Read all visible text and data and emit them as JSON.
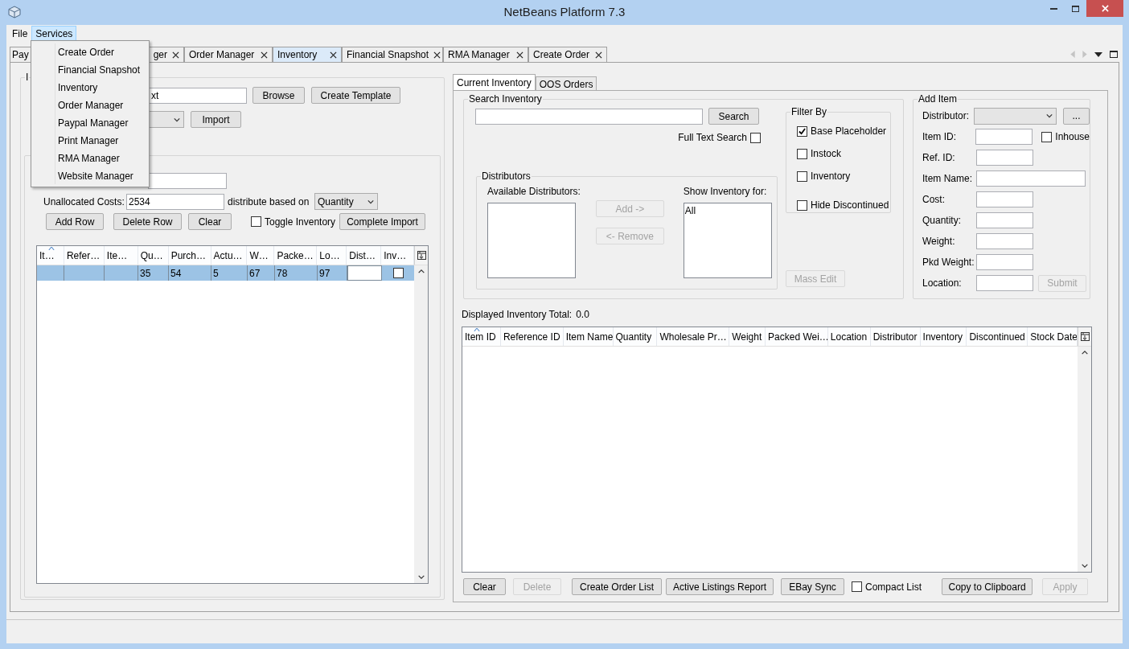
{
  "window": {
    "title": "NetBeans Platform 7.3"
  },
  "menu_bar": [
    {
      "label": "File",
      "selected": false
    },
    {
      "label": "Services",
      "selected": true
    }
  ],
  "services_menu": [
    "Create Order",
    "Financial Snapshot",
    "Inventory",
    "Order Manager",
    "Paypal Manager",
    "Print Manager",
    "RMA Manager",
    "Website Manager"
  ],
  "tabs": [
    {
      "label": "Pay",
      "selected": false,
      "closable": false
    },
    {
      "label": "ger",
      "selected": false,
      "closable": true
    },
    {
      "label": "Order Manager",
      "selected": false,
      "closable": true
    },
    {
      "label": "Inventory",
      "selected": true,
      "closable": true
    },
    {
      "label": "Financial Snapshot",
      "selected": false,
      "closable": true
    },
    {
      "label": "RMA Manager",
      "selected": false,
      "closable": true
    },
    {
      "label": "Create Order",
      "selected": false,
      "closable": true
    }
  ],
  "import_panel": {
    "group_title": "I",
    "file_field": "xt",
    "browse": "Browse",
    "create_template": "Create Template",
    "import": "Import",
    "unallocated_label": "Unallocated Costs:",
    "unallocated_value": "2534",
    "distribute_label": "distribute based on",
    "distribute_value": "Quantity",
    "actions": [
      "Add Row",
      "Delete Row",
      "Clear"
    ],
    "toggle_inventory": {
      "label": "Toggle Inventory",
      "checked": false
    },
    "complete_import": "Complete Import",
    "table": {
      "columns": [
        "It…",
        "Refer…",
        "Ite…",
        "Qu…",
        "Purch…",
        "Actu…",
        "W…",
        "Packe…",
        "Lo…",
        "Dist…",
        "Inv…"
      ],
      "rows": [
        {
          "selected": true,
          "cells": [
            null,
            null,
            null,
            "35",
            "54",
            "5",
            "67",
            "78",
            "97"
          ],
          "inventory_checked": false
        }
      ]
    }
  },
  "inventory_tabs": [
    {
      "label": "Current Inventory",
      "selected": true
    },
    {
      "label": "OOS Orders",
      "selected": false
    }
  ],
  "search": {
    "title": "Search Inventory",
    "button": "Search",
    "full_text": {
      "label": "Full Text Search",
      "checked": false
    }
  },
  "distributors": {
    "title": "Distributors",
    "available_label": "Available Distributors:",
    "add": {
      "label": "Add ->",
      "disabled": true
    },
    "remove": {
      "label": "<- Remove",
      "disabled": true
    },
    "show_label": "Show Inventory for:",
    "show_items": [
      "All"
    ]
  },
  "filter": {
    "title": "Filter By",
    "options": [
      {
        "label": "Base Placeholder",
        "checked": true
      },
      {
        "label": "Instock",
        "checked": false
      },
      {
        "label": "Inventory",
        "checked": false
      },
      {
        "label": "Hide Discontinued",
        "checked": false
      }
    ]
  },
  "mass_edit": {
    "label": "Mass Edit",
    "disabled": true
  },
  "add_item": {
    "title": "Add Item",
    "fields": [
      {
        "label": "Distributor:",
        "kind": "combo",
        "button": "..."
      },
      {
        "label": "Item ID:",
        "kind": "short",
        "checkbox": {
          "label": "Inhouse",
          "checked": false
        }
      },
      {
        "label": "Ref. ID:",
        "kind": "short"
      },
      {
        "label": "Item Name:",
        "kind": "wide"
      },
      {
        "label": "Cost:",
        "kind": "short"
      },
      {
        "label": "Quantity:",
        "kind": "short"
      },
      {
        "label": "Weight:",
        "kind": "short"
      },
      {
        "label": "Pkd Weight:",
        "kind": "short"
      },
      {
        "label": "Location:",
        "kind": "short",
        "submit": {
          "label": "Submit",
          "disabled": true
        }
      }
    ]
  },
  "total": {
    "label": "Displayed Inventory Total:",
    "value": "0.0"
  },
  "inventory_table": {
    "columns": [
      "Item ID",
      "Reference ID",
      "Item Name",
      "Quantity",
      "Wholesale Pr…",
      "Weight",
      "Packed Wei…",
      "Location",
      "Distributor",
      "Inventory",
      "Discontinued",
      "Stock Date"
    ]
  },
  "bottom_controls": [
    {
      "kind": "button",
      "label": "Clear",
      "disabled": false
    },
    {
      "kind": "button",
      "label": "Delete",
      "disabled": true
    },
    {
      "kind": "button",
      "label": "Create Order List",
      "disabled": false
    },
    {
      "kind": "button",
      "label": "Active Listings Report",
      "disabled": false
    },
    {
      "kind": "button",
      "label": "EBay Sync",
      "disabled": false
    },
    {
      "kind": "checkbox",
      "label": "Compact List",
      "checked": false
    },
    {
      "kind": "button",
      "label": "Copy to Clipboard",
      "disabled": false
    },
    {
      "kind": "button",
      "label": "Apply",
      "disabled": true
    }
  ]
}
